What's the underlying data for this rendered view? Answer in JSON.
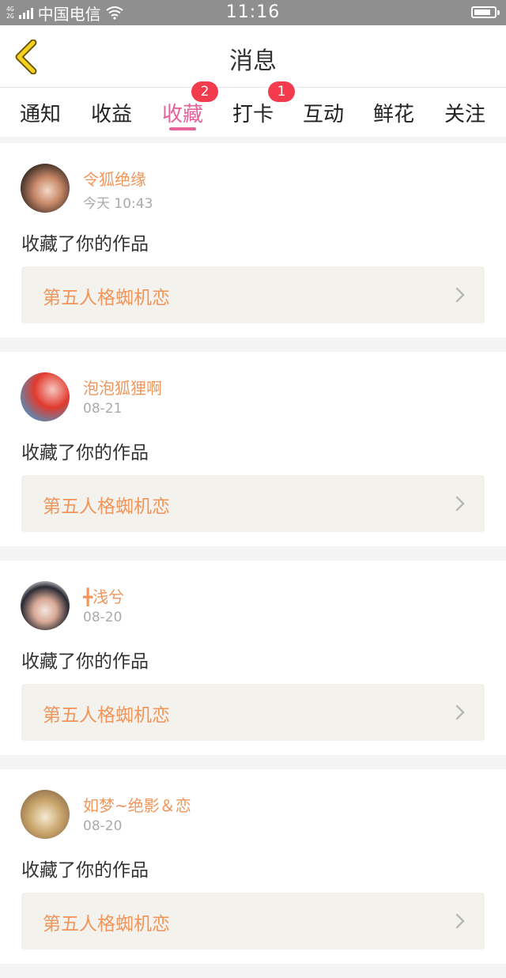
{
  "status_bar": {
    "network_top": "4G",
    "network_bottom": "2G",
    "carrier": "中国电信",
    "time": "11:16"
  },
  "header": {
    "title": "消息"
  },
  "tabs": [
    {
      "label": "通知",
      "badge": ""
    },
    {
      "label": "收益",
      "badge": ""
    },
    {
      "label": "收藏",
      "badge": "2",
      "active": true
    },
    {
      "label": "打卡",
      "badge": "1"
    },
    {
      "label": "互动",
      "badge": ""
    },
    {
      "label": "鲜花",
      "badge": ""
    },
    {
      "label": "关注",
      "badge": ""
    }
  ],
  "notifications": [
    {
      "user": "令狐绝缘",
      "time": "今天 10:43",
      "action": "收藏了你的作品",
      "work": "第五人格蜘机恋",
      "avatar_colors": [
        "#3a2a22",
        "#c98a6a",
        "#f1d8c8"
      ]
    },
    {
      "user": "泡泡狐狸啊",
      "time": "08-21",
      "action": "收藏了你的作品",
      "work": "第五人格蜘机恋",
      "avatar_colors": [
        "#5d88b0",
        "#e23a2e",
        "#f4c7c0"
      ]
    },
    {
      "user": "╋浅兮",
      "time": "08-20",
      "action": "收藏了你的作品",
      "work": "第五人格蜘机恋",
      "avatar_colors": [
        "#2a2a33",
        "#f2e6df",
        "#d9a996"
      ]
    },
    {
      "user": "如梦~绝影＆恋",
      "time": "08-20",
      "action": "收藏了你的作品",
      "work": "第五人格蜘机恋",
      "avatar_colors": [
        "#c9a56b",
        "#f5ead2",
        "#8a6b48"
      ]
    }
  ]
}
